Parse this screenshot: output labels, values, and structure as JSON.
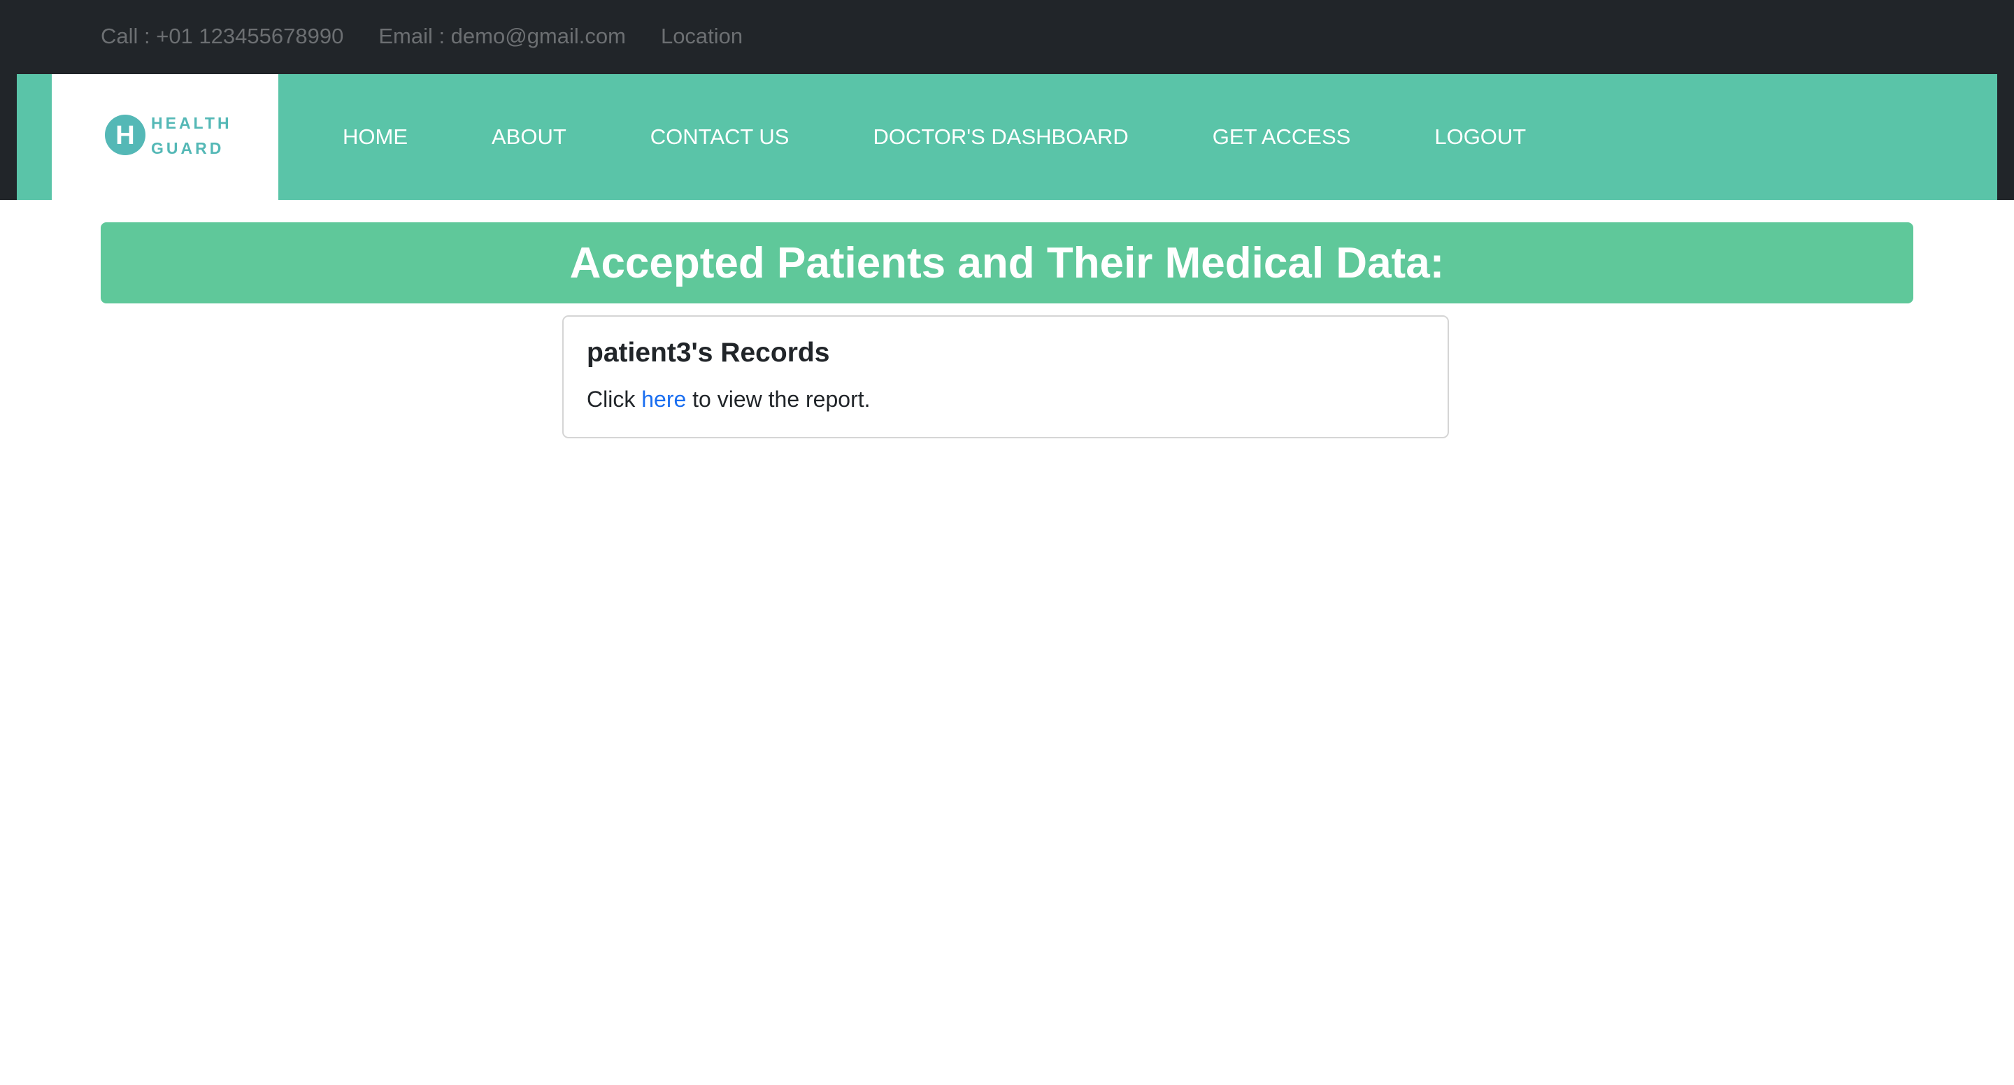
{
  "topbar": {
    "call": "Call : +01 123455678990",
    "email": "Email : demo@gmail.com",
    "location": "Location"
  },
  "logo": {
    "icon_letter": "H",
    "line1": "HEALTH",
    "line2": "GUARD"
  },
  "nav": {
    "items": [
      {
        "label": "HOME"
      },
      {
        "label": "ABOUT"
      },
      {
        "label": "CONTACT US"
      },
      {
        "label": "DOCTOR'S DASHBOARD"
      },
      {
        "label": "GET ACCESS"
      },
      {
        "label": "LOGOUT"
      }
    ]
  },
  "banner": {
    "title": "Accepted Patients and Their Medical Data:"
  },
  "records": [
    {
      "title": "patient3's Records",
      "text_before": "Click ",
      "link_label": "here",
      "text_after": " to view the report."
    }
  ],
  "colors": {
    "topbar": "#212529",
    "navbar": "#5ac4a8",
    "banner": "#5fc89a",
    "logo": "#54b8b6",
    "link": "#1a6ef0"
  }
}
